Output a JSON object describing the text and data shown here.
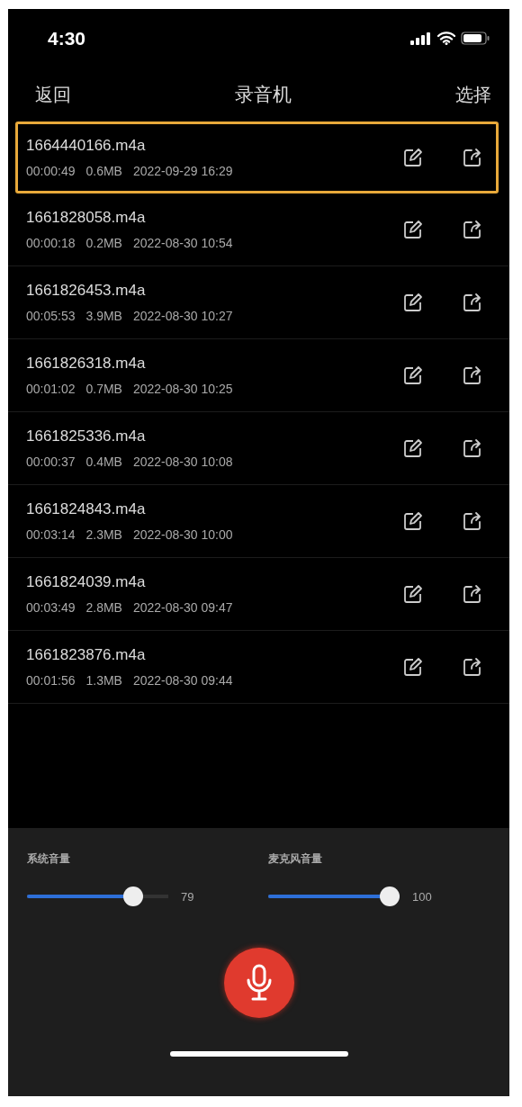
{
  "status_bar": {
    "time": "4:30"
  },
  "nav": {
    "back": "返回",
    "title": "录音机",
    "action": "选择"
  },
  "recordings": [
    {
      "name": "1664440166.m4a",
      "duration": "00:00:49",
      "size": "0.6MB",
      "date": "2022-09-29 16:29",
      "selected": true
    },
    {
      "name": "1661828058.m4a",
      "duration": "00:00:18",
      "size": "0.2MB",
      "date": "2022-08-30 10:54",
      "selected": false
    },
    {
      "name": "1661826453.m4a",
      "duration": "00:05:53",
      "size": "3.9MB",
      "date": "2022-08-30 10:27",
      "selected": false
    },
    {
      "name": "1661826318.m4a",
      "duration": "00:01:02",
      "size": "0.7MB",
      "date": "2022-08-30 10:25",
      "selected": false
    },
    {
      "name": "1661825336.m4a",
      "duration": "00:00:37",
      "size": "0.4MB",
      "date": "2022-08-30 10:08",
      "selected": false
    },
    {
      "name": "1661824843.m4a",
      "duration": "00:03:14",
      "size": "2.3MB",
      "date": "2022-08-30 10:00",
      "selected": false
    },
    {
      "name": "1661824039.m4a",
      "duration": "00:03:49",
      "size": "2.8MB",
      "date": "2022-08-30 09:47",
      "selected": false
    },
    {
      "name": "1661823876.m4a",
      "duration": "00:01:56",
      "size": "1.3MB",
      "date": "2022-08-30 09:44",
      "selected": false
    }
  ],
  "volumes": [
    {
      "label": "系统音量",
      "level": 0.79,
      "reading": "79"
    },
    {
      "label": "麦克风音量",
      "level": 1.0,
      "reading": "100"
    }
  ]
}
